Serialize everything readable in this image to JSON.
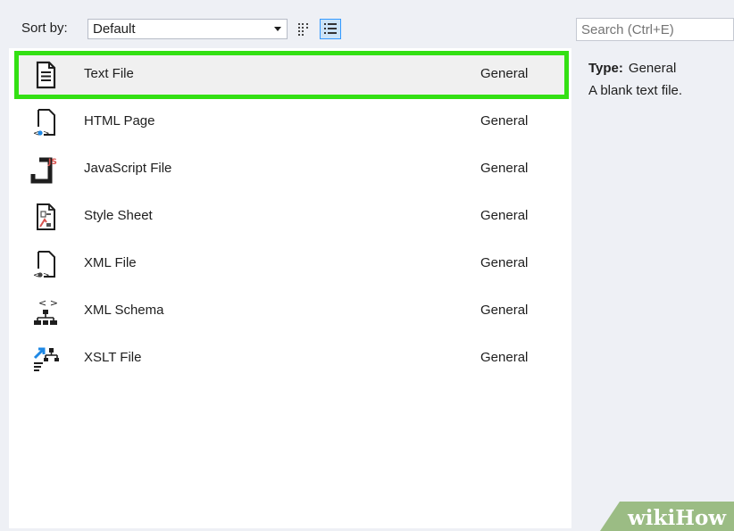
{
  "toolbar": {
    "sort_label": "Sort by:",
    "sort_value": "Default",
    "view_small_icons": "small-icons-view-icon",
    "view_list": "list-view-icon"
  },
  "search": {
    "placeholder": "Search (Ctrl+E)"
  },
  "templates": [
    {
      "name": "Text File",
      "category": "General",
      "icon": "text-file-icon",
      "selected": true
    },
    {
      "name": "HTML Page",
      "category": "General",
      "icon": "html-page-icon",
      "selected": false
    },
    {
      "name": "JavaScript File",
      "category": "General",
      "icon": "javascript-file-icon",
      "selected": false
    },
    {
      "name": "Style Sheet",
      "category": "General",
      "icon": "style-sheet-icon",
      "selected": false
    },
    {
      "name": "XML File",
      "category": "General",
      "icon": "xml-file-icon",
      "selected": false
    },
    {
      "name": "XML Schema",
      "category": "General",
      "icon": "xml-schema-icon",
      "selected": false
    },
    {
      "name": "XSLT File",
      "category": "General",
      "icon": "xslt-file-icon",
      "selected": false
    }
  ],
  "details": {
    "type_label": "Type:",
    "type_value": "General",
    "description": "A blank text file."
  },
  "watermark": {
    "text": "wikiHow"
  },
  "colors": {
    "highlight": "#33e013",
    "accent": "#3399ff",
    "pane_bg": "#eef0f5",
    "selected_row": "#f0f0f0"
  }
}
